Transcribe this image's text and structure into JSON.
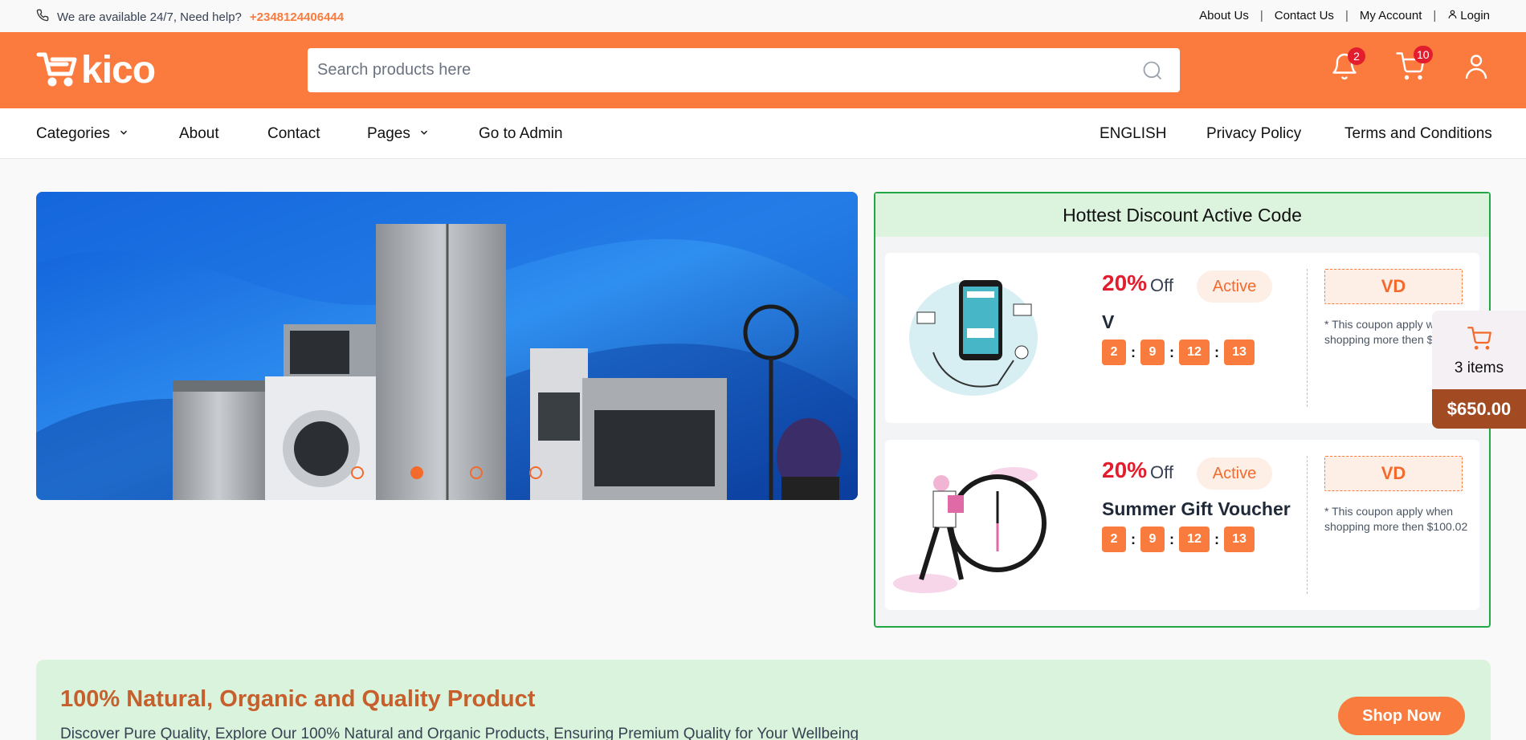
{
  "topbar": {
    "availability": "We are available 24/7, Need help?",
    "phone": "+2348124406444",
    "links": [
      "About Us",
      "Contact Us",
      "My Account"
    ],
    "login": "Login"
  },
  "header": {
    "brand": "kico",
    "search_placeholder": "Search products here",
    "notifications_count": "2",
    "cart_count": "10"
  },
  "nav": {
    "categories": "Categories",
    "about": "About",
    "contact": "Contact",
    "pages": "Pages",
    "admin": "Go to Admin",
    "language": "ENGLISH",
    "privacy": "Privacy Policy",
    "terms": "Terms and Conditions"
  },
  "hero": {
    "active_slide": 2,
    "slide_count": 4
  },
  "discount": {
    "heading": "Hottest Discount Active Code",
    "coupons": [
      {
        "percent": "20%",
        "off": "Off",
        "status": "Active",
        "title": "V",
        "timer": [
          "2",
          "9",
          "12",
          "13"
        ],
        "code": "VD",
        "note": "* This coupon apply when shopping more then $100.02"
      },
      {
        "percent": "20%",
        "off": "Off",
        "status": "Active",
        "title": "Summer Gift Voucher",
        "timer": [
          "2",
          "9",
          "12",
          "13"
        ],
        "code": "VD",
        "note": "* This coupon apply when shopping more then $100.02"
      }
    ]
  },
  "floating_cart": {
    "items": "3 items",
    "total": "$650.00"
  },
  "promo": {
    "title": "100% Natural, Organic and Quality Product",
    "subtitle": "Discover Pure Quality, Explore Our 100% Natural and Organic Products, Ensuring Premium Quality for Your Wellbeing",
    "button": "Shop Now"
  },
  "colors": {
    "brand_orange": "#fb7b3f",
    "active_green": "#22a745",
    "discount_red": "#e11d2e"
  }
}
